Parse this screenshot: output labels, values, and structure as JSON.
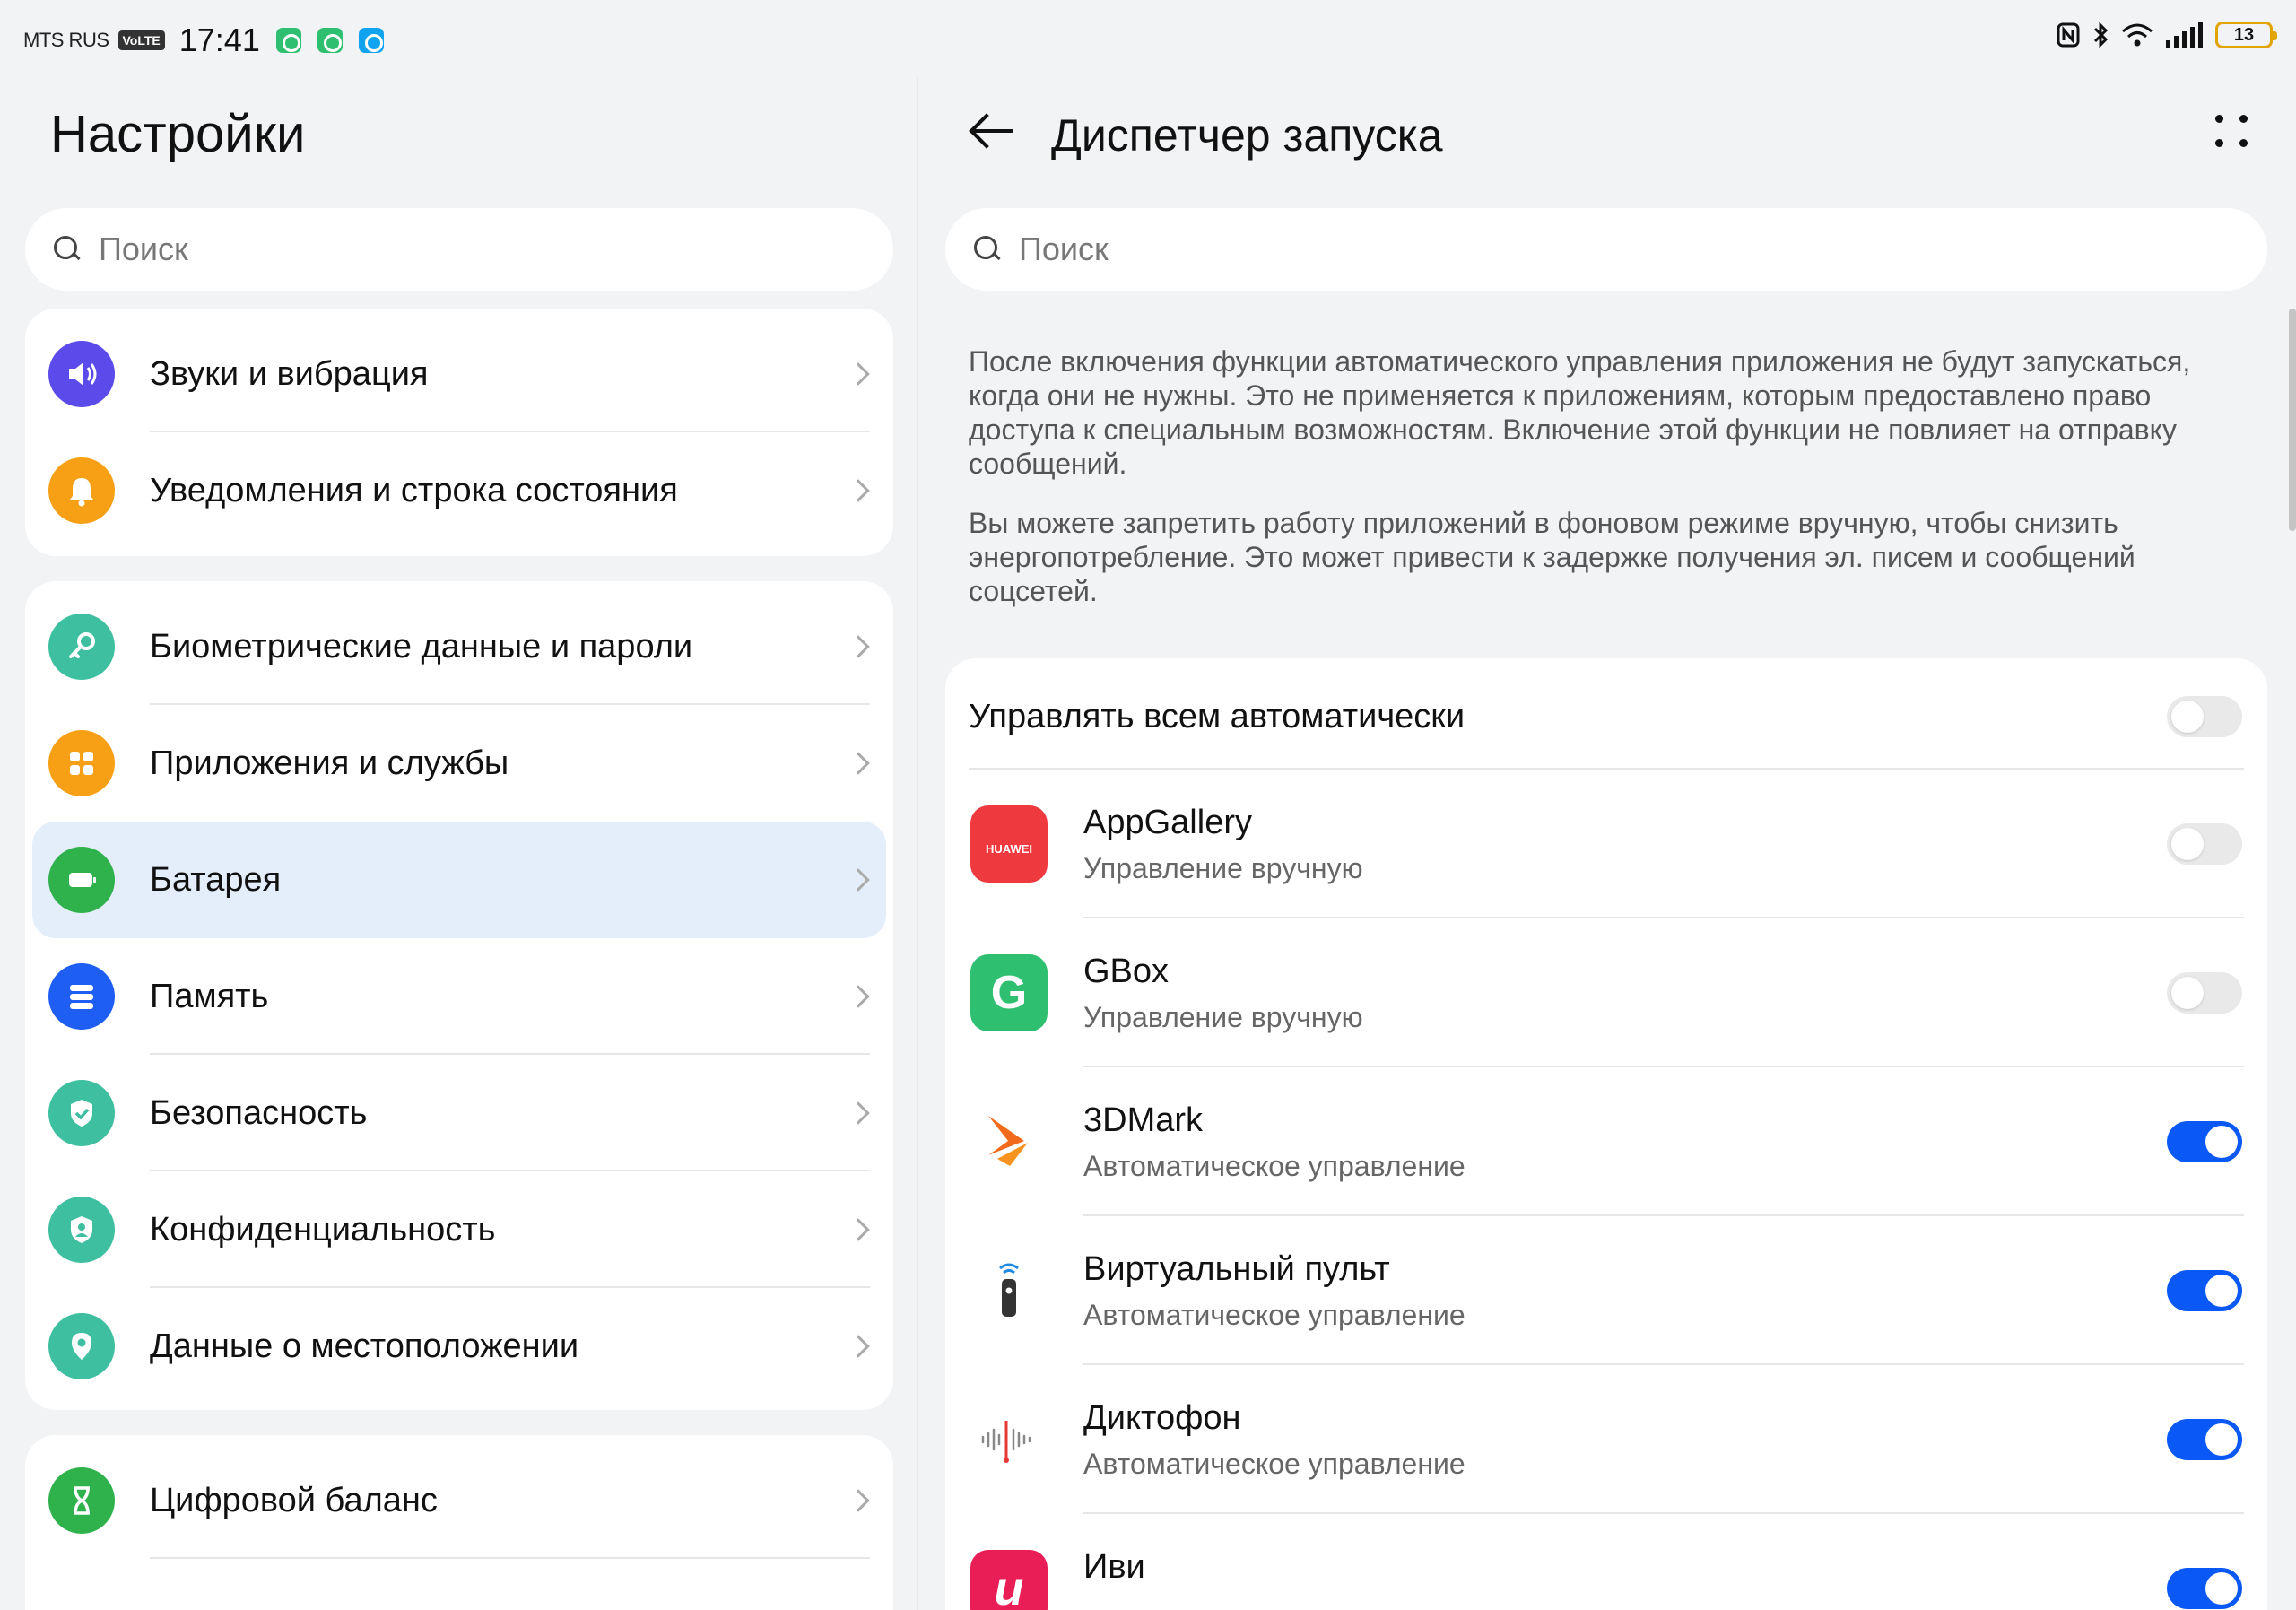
{
  "status_bar": {
    "carrier": "MTS RUS",
    "volte": "VoLTE",
    "time": "17:41",
    "battery_level": "13",
    "notification_icons": [
      "gbox-notification-icon",
      "gbox-notification-icon",
      "message-notification-icon"
    ],
    "status_icons": [
      "nfc-icon",
      "bluetooth-icon",
      "wifi-icon",
      "signal-icon",
      "battery-icon"
    ]
  },
  "left_panel": {
    "title": "Настройки",
    "search_placeholder": "Поиск",
    "groups": [
      {
        "items": [
          {
            "label": "Звуки и вибрация",
            "icon": "sound-icon",
            "color": "#5b4bea"
          },
          {
            "label": "Уведомления и строка состояния",
            "icon": "bell-icon",
            "color": "#f7a016"
          }
        ]
      },
      {
        "items": [
          {
            "label": "Биометрические данные и пароли",
            "icon": "key-icon",
            "color": "#3dbfa0"
          },
          {
            "label": "Приложения и службы",
            "icon": "apps-icon",
            "color": "#f7a016"
          },
          {
            "label": "Батарея",
            "icon": "battery-icon",
            "color": "#2fb24c",
            "selected": true
          },
          {
            "label": "Память",
            "icon": "storage-icon",
            "color": "#1e5ef3"
          },
          {
            "label": "Безопасность",
            "icon": "shield-icon",
            "color": "#3dbfa0"
          },
          {
            "label": "Конфиденциальность",
            "icon": "privacy-icon",
            "color": "#3dbfa0"
          },
          {
            "label": "Данные о местоположении",
            "icon": "location-icon",
            "color": "#3dbfa0"
          }
        ]
      },
      {
        "items": [
          {
            "label": "Цифровой баланс",
            "icon": "hourglass-icon",
            "color": "#2fb24c"
          }
        ]
      }
    ]
  },
  "right_panel": {
    "title": "Диспетчер запуска",
    "search_placeholder": "Поиск",
    "description_1": "После включения функции автоматического управления приложения не будут запускаться, когда они не нужны. Это не применяется к приложениям, которым предоставлено право доступа к специальным возможностям. Включение этой функции не повлияет на отправку сообщений.",
    "description_2": "Вы можете запретить работу приложений в фоновом режиме вручную, чтобы снизить энергопотребление. Это может привести к задержке получения эл. писем и сообщений соцсетей.",
    "master_toggle_label": "Управлять всем автоматически",
    "master_toggle_on": false,
    "apps": [
      {
        "name": "AppGallery",
        "status": "Управление вручную",
        "on": false,
        "icon": "appgallery-icon",
        "icon_text": "HUAWEI"
      },
      {
        "name": "GBox",
        "status": "Управление вручную",
        "on": false,
        "icon": "gbox-icon",
        "icon_text": "G"
      },
      {
        "name": "3DMark",
        "status": "Автоматическое управление",
        "on": true,
        "icon": "3dmark-icon"
      },
      {
        "name": "Виртуальный пульт",
        "status": "Автоматическое управление",
        "on": true,
        "icon": "remote-icon"
      },
      {
        "name": "Диктофон",
        "status": "Автоматическое управление",
        "on": true,
        "icon": "recorder-icon"
      },
      {
        "name": "Иви",
        "status": "",
        "on": true,
        "icon": "ivi-icon",
        "icon_text": "и"
      }
    ]
  },
  "colors": {
    "accent": "#0a59f7",
    "selected_row": "#e4eefb",
    "background": "#f1f3f5"
  }
}
